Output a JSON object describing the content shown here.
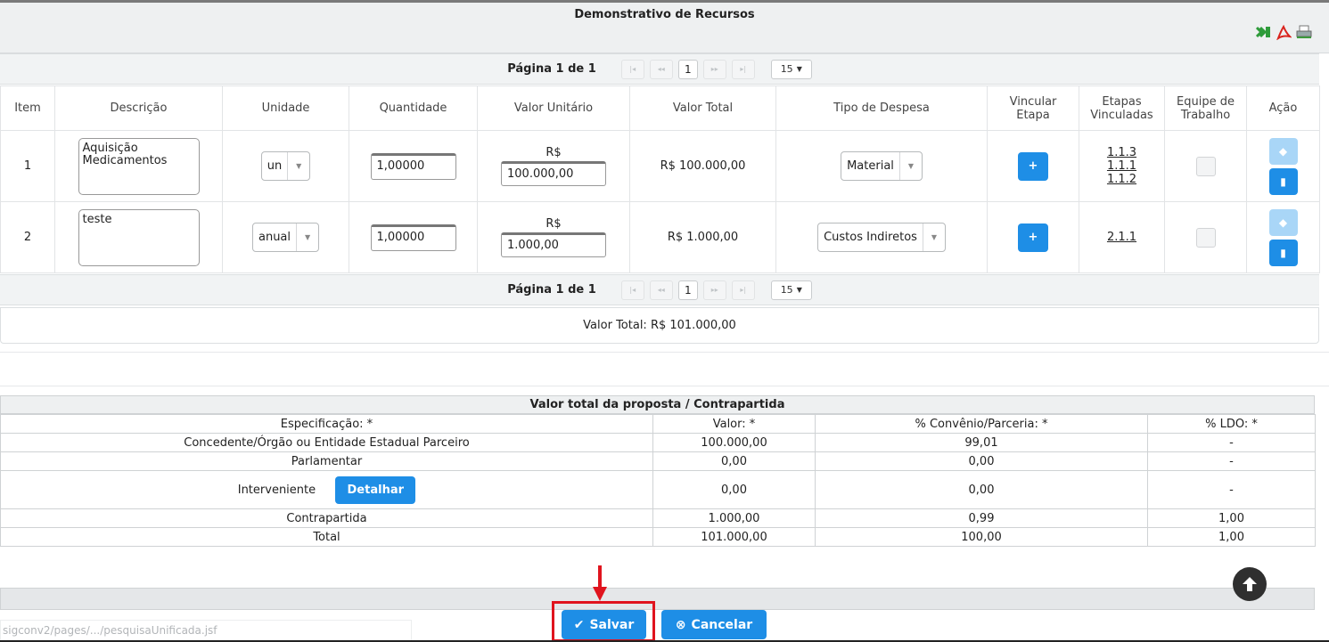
{
  "panel": {
    "title": "Demonstrativo de Recursos",
    "export_icons": [
      "excel-icon",
      "pdf-icon",
      "print-icon"
    ]
  },
  "pager": {
    "text": "Página 1 de 1",
    "first": "|◂",
    "prev": "◂◂",
    "page": "1",
    "next": "▸▸",
    "last": "▸|",
    "page_size": "15",
    "page_size_caret": "▼"
  },
  "items_table": {
    "headers": {
      "item": "Item",
      "descricao": "Descrição",
      "unidade": "Unidade",
      "quantidade": "Quantidade",
      "valor_unitario": "Valor Unitário",
      "valor_total": "Valor Total",
      "tipo_despesa": "Tipo de Despesa",
      "vincular_1": "Vincular",
      "vincular_2": "Etapa",
      "etapas_1": "Etapas",
      "etapas_2": "Vinculadas",
      "equipe_1": "Equipe de",
      "equipe_2": "Trabalho",
      "acao": "Ação"
    },
    "rows": [
      {
        "item": "1",
        "descricao": "Aquisição Medicamentos",
        "unidade": "un",
        "quantidade": "1,00000",
        "currency": "R$",
        "valor_unitario": "100.000,00",
        "valor_total": "R$ 100.000,00",
        "tipo_despesa": "Material",
        "etapas": [
          "1.1.3",
          "1.1.1",
          "1.1.2"
        ]
      },
      {
        "item": "2",
        "descricao": "teste",
        "unidade": "anual",
        "quantidade": "1,00000",
        "currency": "R$",
        "valor_unitario": "1.000,00",
        "valor_total": "R$ 1.000,00",
        "tipo_despesa": "Custos Indiretos",
        "etapas": [
          "2.1.1"
        ]
      }
    ]
  },
  "total": {
    "text": "Valor Total: R$ 101.000,00"
  },
  "contrapartida": {
    "title": "Valor total da proposta / Contrapartida",
    "headers": [
      "Especificação: *",
      "Valor: *",
      "% Convênio/Parceria: *",
      "% LDO: *"
    ],
    "rows": [
      {
        "spec": "Concedente/Órgão ou Entidade Estadual Parceiro",
        "valor": "100.000,00",
        "conv": "99,01",
        "ldo": "-"
      },
      {
        "spec": "Parlamentar",
        "valor": "0,00",
        "conv": "0,00",
        "ldo": "-"
      },
      {
        "spec": "Interveniente",
        "valor": "0,00",
        "conv": "0,00",
        "ldo": "-",
        "button": "Detalhar"
      },
      {
        "spec": "Contrapartida",
        "valor": "1.000,00",
        "conv": "0,99",
        "ldo": "1,00"
      },
      {
        "spec": "Total",
        "valor": "101.000,00",
        "conv": "100,00",
        "ldo": "1,00"
      }
    ]
  },
  "footer": {
    "url": "sigconv2/pages/.../pesquisaUnificada.jsf",
    "save_label": "Salvar",
    "cancel_label": "Cancelar"
  },
  "colors": {
    "primary_button": "#1e8ee6",
    "highlight": "#e0141e",
    "header_bg": "#eef0f1"
  }
}
